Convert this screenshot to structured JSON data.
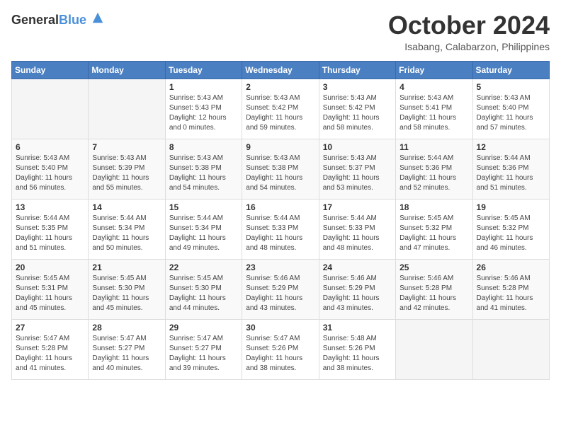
{
  "logo": {
    "general": "General",
    "blue": "Blue"
  },
  "header": {
    "month": "October 2024",
    "location": "Isabang, Calabarzon, Philippines"
  },
  "weekdays": [
    "Sunday",
    "Monday",
    "Tuesday",
    "Wednesday",
    "Thursday",
    "Friday",
    "Saturday"
  ],
  "weeks": [
    [
      {
        "day": "",
        "info": ""
      },
      {
        "day": "",
        "info": ""
      },
      {
        "day": "1",
        "info": "Sunrise: 5:43 AM\nSunset: 5:43 PM\nDaylight: 12 hours\nand 0 minutes."
      },
      {
        "day": "2",
        "info": "Sunrise: 5:43 AM\nSunset: 5:42 PM\nDaylight: 11 hours\nand 59 minutes."
      },
      {
        "day": "3",
        "info": "Sunrise: 5:43 AM\nSunset: 5:42 PM\nDaylight: 11 hours\nand 58 minutes."
      },
      {
        "day": "4",
        "info": "Sunrise: 5:43 AM\nSunset: 5:41 PM\nDaylight: 11 hours\nand 58 minutes."
      },
      {
        "day": "5",
        "info": "Sunrise: 5:43 AM\nSunset: 5:40 PM\nDaylight: 11 hours\nand 57 minutes."
      }
    ],
    [
      {
        "day": "6",
        "info": "Sunrise: 5:43 AM\nSunset: 5:40 PM\nDaylight: 11 hours\nand 56 minutes."
      },
      {
        "day": "7",
        "info": "Sunrise: 5:43 AM\nSunset: 5:39 PM\nDaylight: 11 hours\nand 55 minutes."
      },
      {
        "day": "8",
        "info": "Sunrise: 5:43 AM\nSunset: 5:38 PM\nDaylight: 11 hours\nand 54 minutes."
      },
      {
        "day": "9",
        "info": "Sunrise: 5:43 AM\nSunset: 5:38 PM\nDaylight: 11 hours\nand 54 minutes."
      },
      {
        "day": "10",
        "info": "Sunrise: 5:43 AM\nSunset: 5:37 PM\nDaylight: 11 hours\nand 53 minutes."
      },
      {
        "day": "11",
        "info": "Sunrise: 5:44 AM\nSunset: 5:36 PM\nDaylight: 11 hours\nand 52 minutes."
      },
      {
        "day": "12",
        "info": "Sunrise: 5:44 AM\nSunset: 5:36 PM\nDaylight: 11 hours\nand 51 minutes."
      }
    ],
    [
      {
        "day": "13",
        "info": "Sunrise: 5:44 AM\nSunset: 5:35 PM\nDaylight: 11 hours\nand 51 minutes."
      },
      {
        "day": "14",
        "info": "Sunrise: 5:44 AM\nSunset: 5:34 PM\nDaylight: 11 hours\nand 50 minutes."
      },
      {
        "day": "15",
        "info": "Sunrise: 5:44 AM\nSunset: 5:34 PM\nDaylight: 11 hours\nand 49 minutes."
      },
      {
        "day": "16",
        "info": "Sunrise: 5:44 AM\nSunset: 5:33 PM\nDaylight: 11 hours\nand 48 minutes."
      },
      {
        "day": "17",
        "info": "Sunrise: 5:44 AM\nSunset: 5:33 PM\nDaylight: 11 hours\nand 48 minutes."
      },
      {
        "day": "18",
        "info": "Sunrise: 5:45 AM\nSunset: 5:32 PM\nDaylight: 11 hours\nand 47 minutes."
      },
      {
        "day": "19",
        "info": "Sunrise: 5:45 AM\nSunset: 5:32 PM\nDaylight: 11 hours\nand 46 minutes."
      }
    ],
    [
      {
        "day": "20",
        "info": "Sunrise: 5:45 AM\nSunset: 5:31 PM\nDaylight: 11 hours\nand 45 minutes."
      },
      {
        "day": "21",
        "info": "Sunrise: 5:45 AM\nSunset: 5:30 PM\nDaylight: 11 hours\nand 45 minutes."
      },
      {
        "day": "22",
        "info": "Sunrise: 5:45 AM\nSunset: 5:30 PM\nDaylight: 11 hours\nand 44 minutes."
      },
      {
        "day": "23",
        "info": "Sunrise: 5:46 AM\nSunset: 5:29 PM\nDaylight: 11 hours\nand 43 minutes."
      },
      {
        "day": "24",
        "info": "Sunrise: 5:46 AM\nSunset: 5:29 PM\nDaylight: 11 hours\nand 43 minutes."
      },
      {
        "day": "25",
        "info": "Sunrise: 5:46 AM\nSunset: 5:28 PM\nDaylight: 11 hours\nand 42 minutes."
      },
      {
        "day": "26",
        "info": "Sunrise: 5:46 AM\nSunset: 5:28 PM\nDaylight: 11 hours\nand 41 minutes."
      }
    ],
    [
      {
        "day": "27",
        "info": "Sunrise: 5:47 AM\nSunset: 5:28 PM\nDaylight: 11 hours\nand 41 minutes."
      },
      {
        "day": "28",
        "info": "Sunrise: 5:47 AM\nSunset: 5:27 PM\nDaylight: 11 hours\nand 40 minutes."
      },
      {
        "day": "29",
        "info": "Sunrise: 5:47 AM\nSunset: 5:27 PM\nDaylight: 11 hours\nand 39 minutes."
      },
      {
        "day": "30",
        "info": "Sunrise: 5:47 AM\nSunset: 5:26 PM\nDaylight: 11 hours\nand 38 minutes."
      },
      {
        "day": "31",
        "info": "Sunrise: 5:48 AM\nSunset: 5:26 PM\nDaylight: 11 hours\nand 38 minutes."
      },
      {
        "day": "",
        "info": ""
      },
      {
        "day": "",
        "info": ""
      }
    ]
  ]
}
